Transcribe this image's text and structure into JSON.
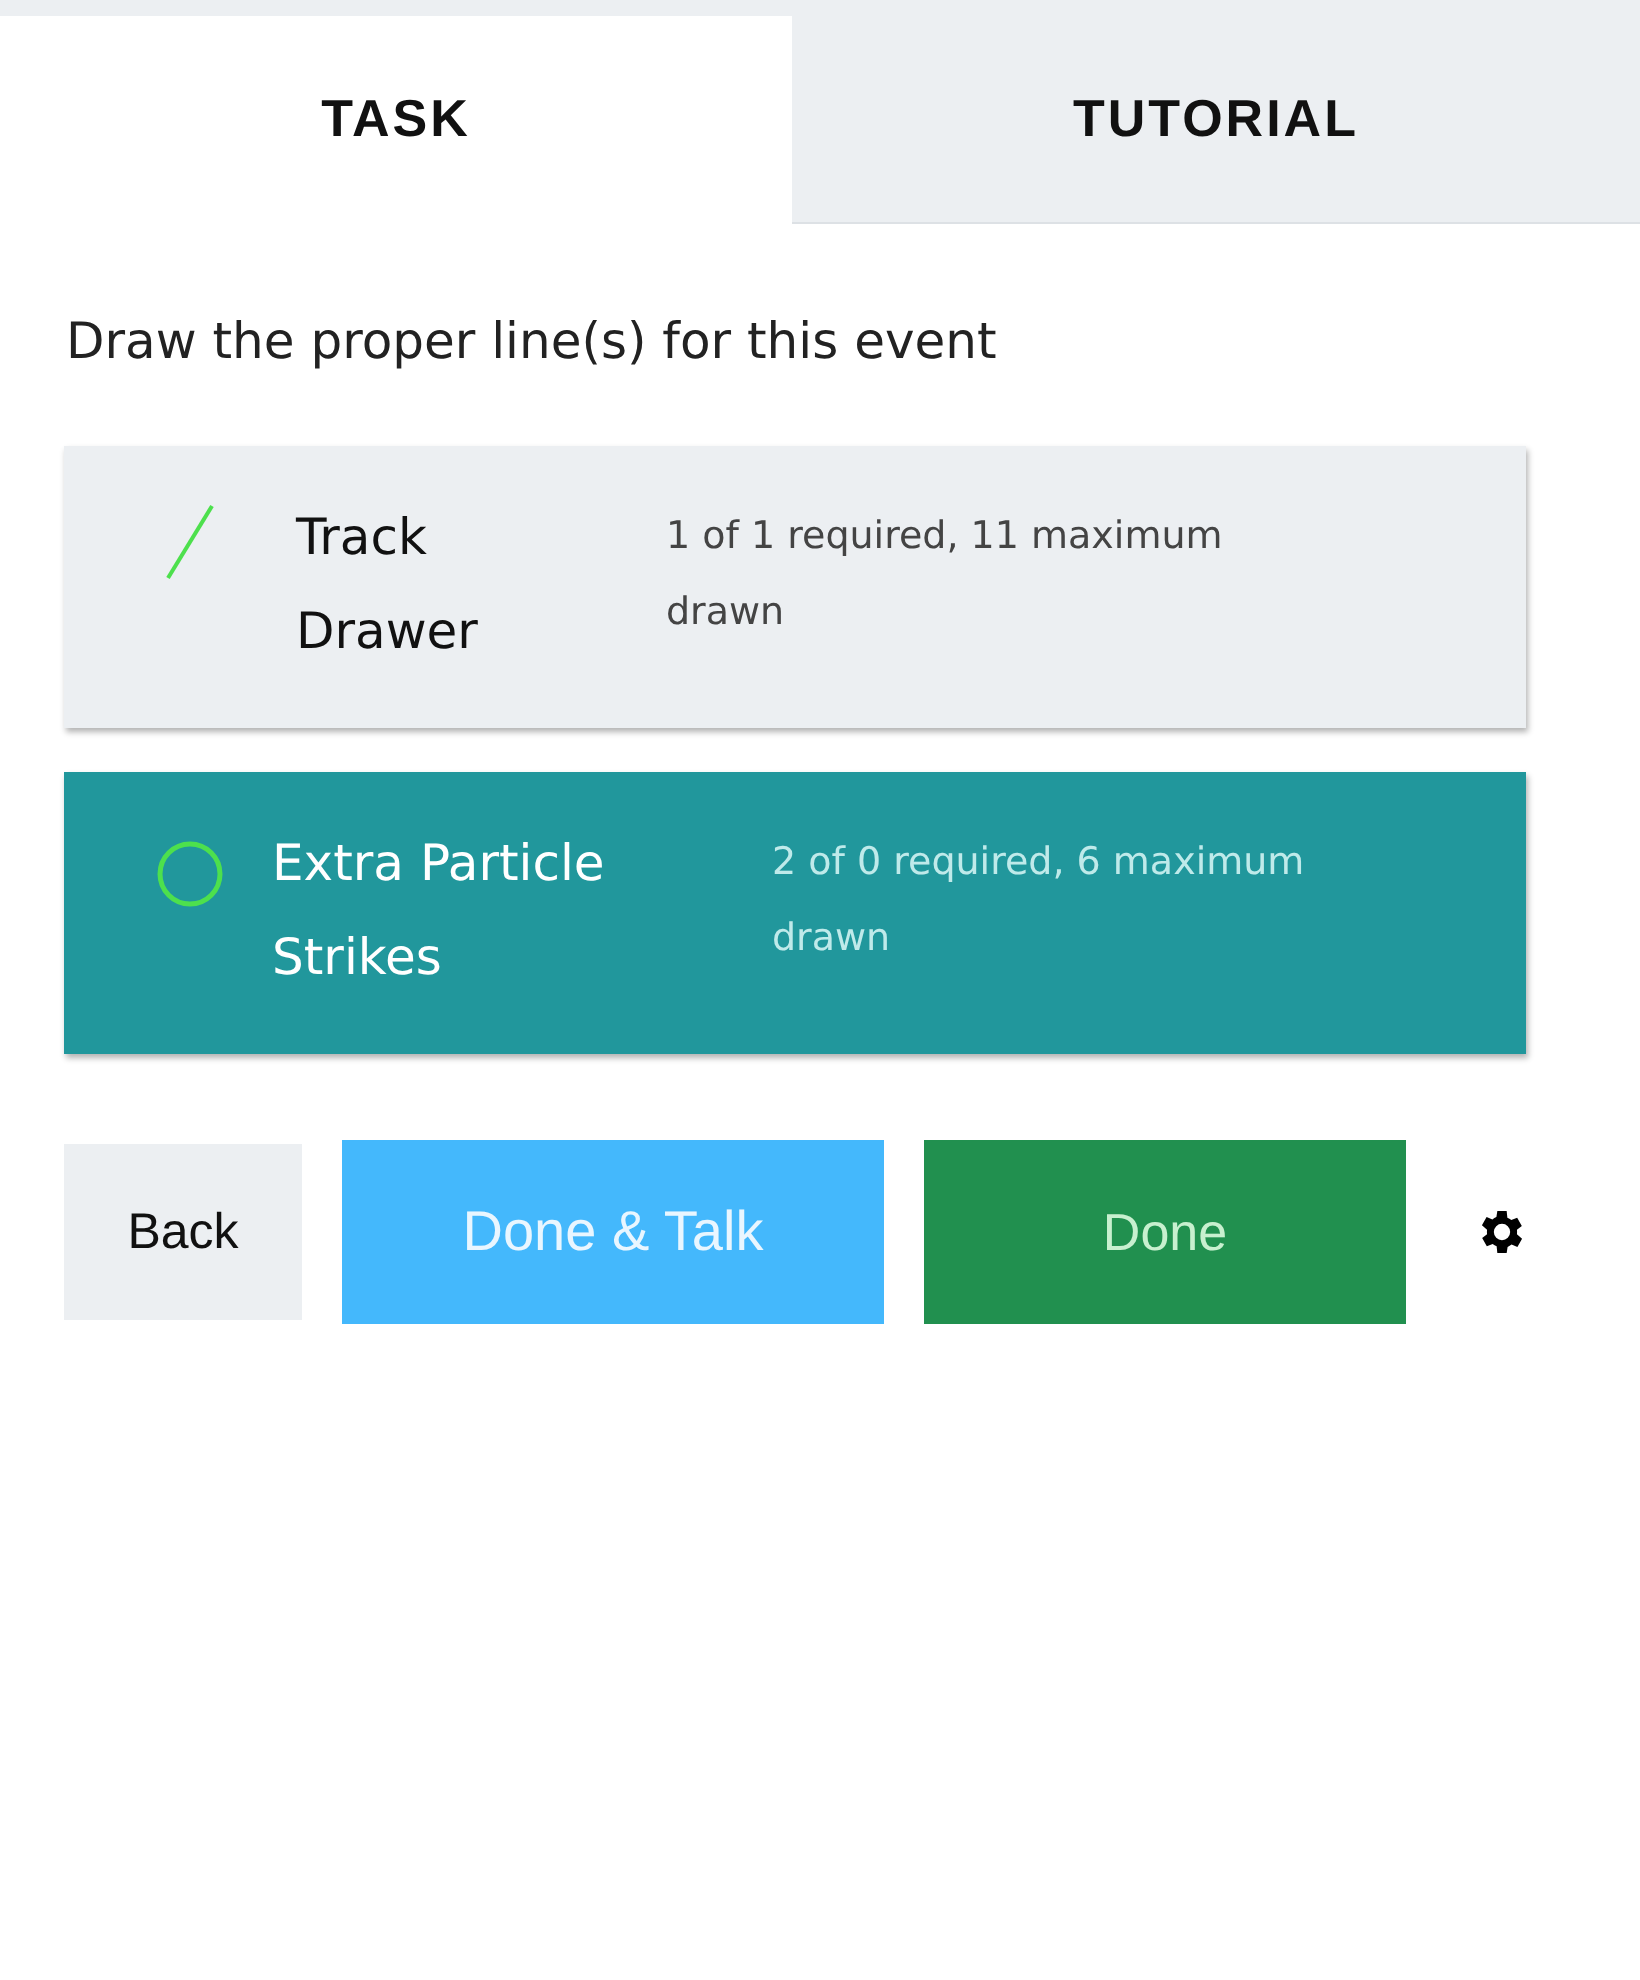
{
  "tabs": [
    {
      "label": "TASK",
      "selected": true
    },
    {
      "label": "TUTORIAL",
      "selected": false
    }
  ],
  "instruction": "Draw the proper line(s) for this event",
  "tools": [
    {
      "kind": "line",
      "name": "Track Drawer",
      "details": "1 of 1 required, 11 maximum drawn",
      "selected": false
    },
    {
      "kind": "circle",
      "name": "Extra Particle Strikes",
      "details": "2 of 0 required, 6 maximum drawn",
      "selected": true
    }
  ],
  "buttons": [
    {
      "kind": "back",
      "label": "Back"
    },
    {
      "kind": "talk",
      "label": "Done & Talk"
    },
    {
      "kind": "done",
      "label": "Done"
    }
  ]
}
